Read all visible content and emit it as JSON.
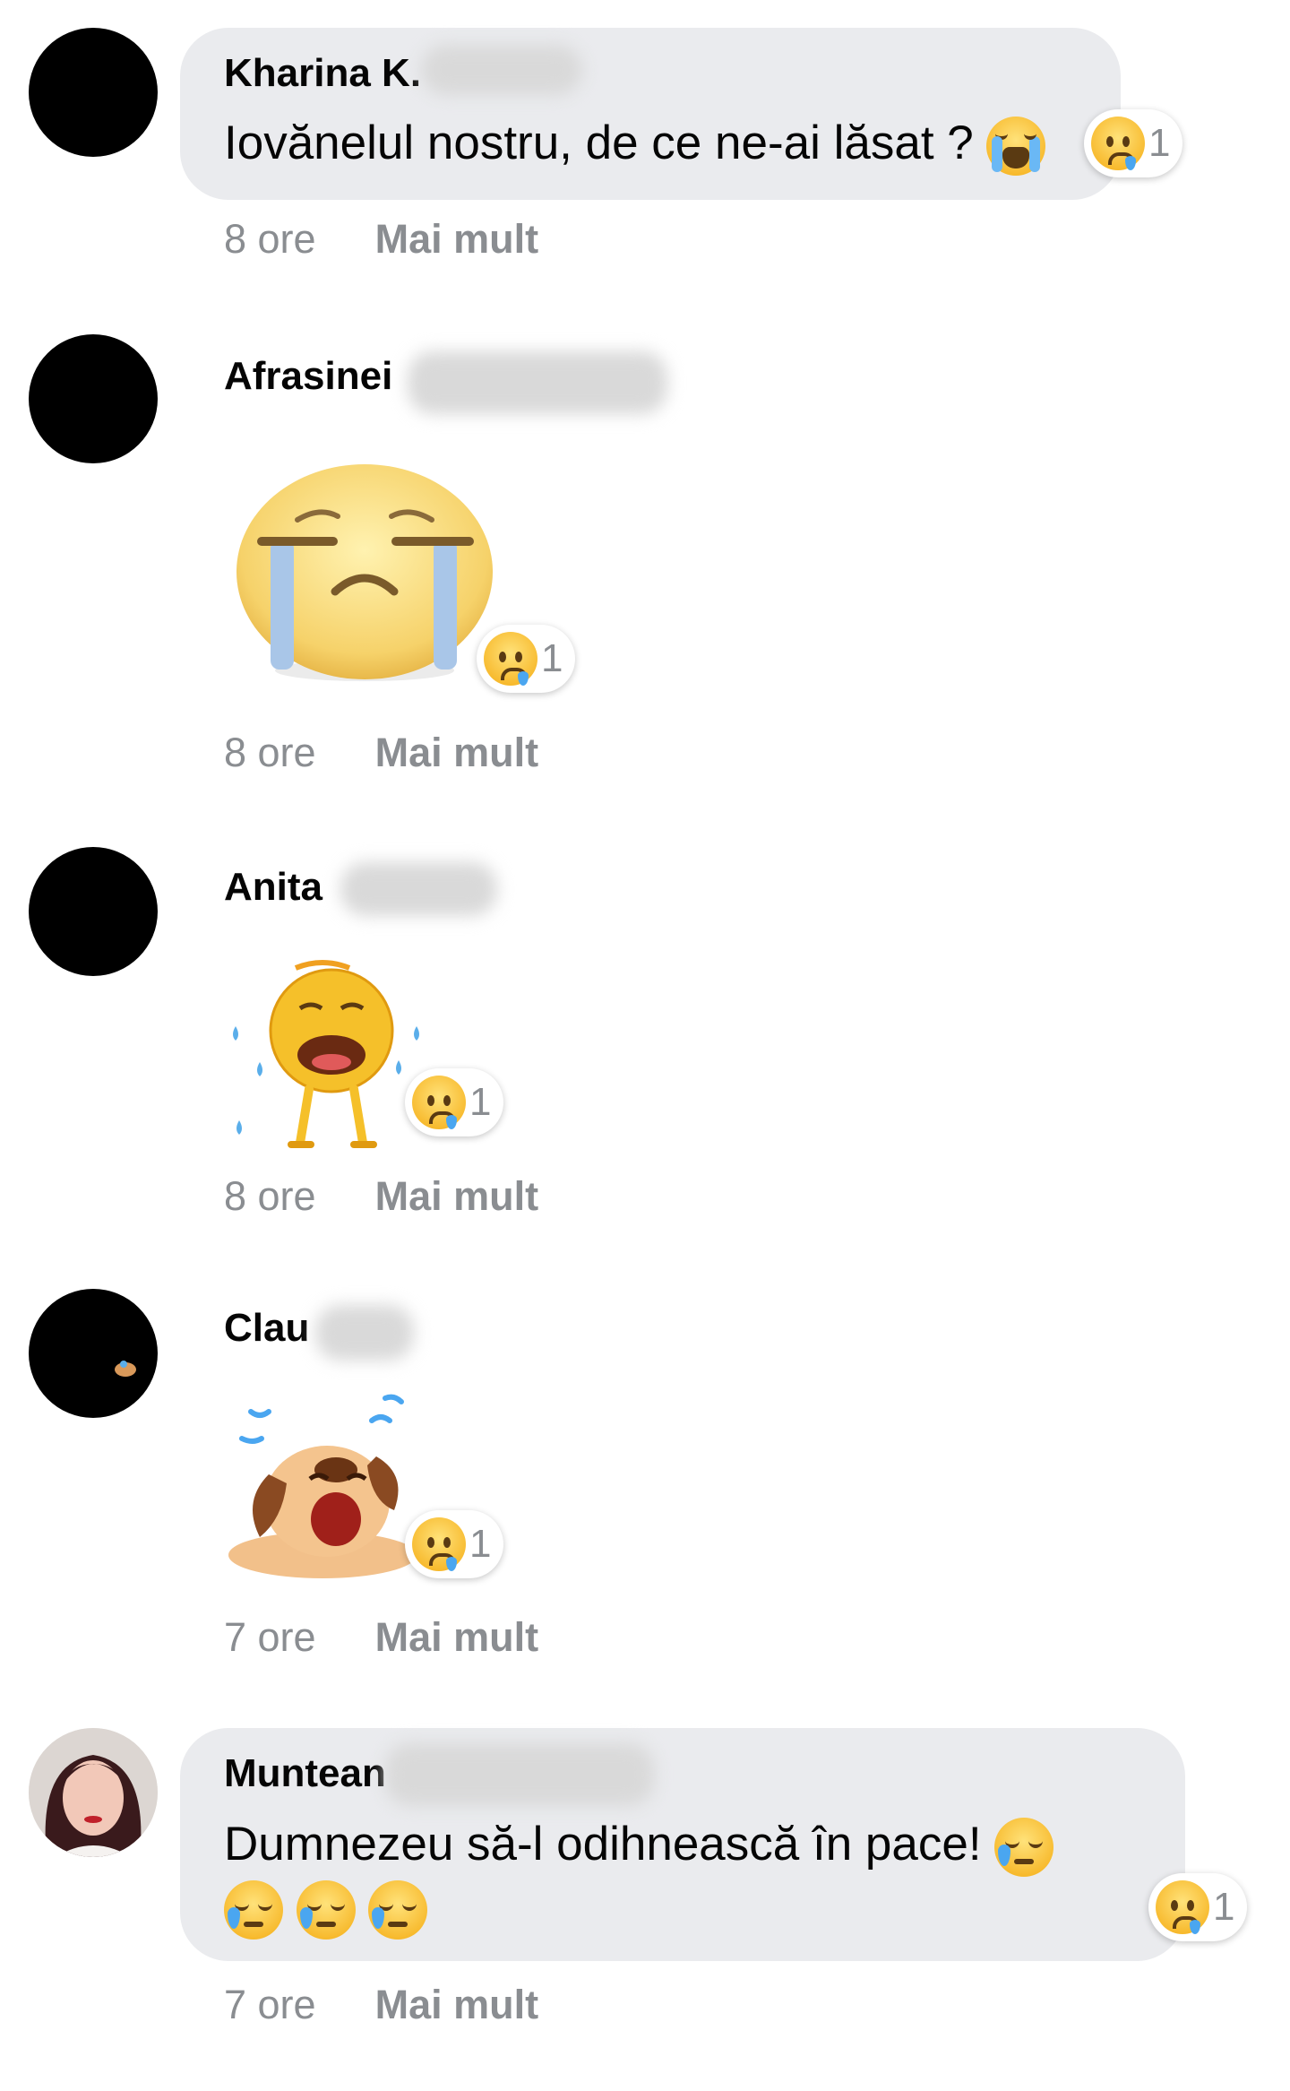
{
  "comments": [
    {
      "author": "Kharina K.",
      "text": "Iovănelul nostru, de ce ne-ai lăsat ?",
      "text_emoji": "loudly-crying-face",
      "reaction_icon": "crying-face-icon",
      "reaction_count": "1",
      "time": "8 ore",
      "more": "Mai mult"
    },
    {
      "author": "Afrasinei",
      "sticker": "big-crying-face-sticker",
      "reaction_icon": "crying-face-icon",
      "reaction_count": "1",
      "time": "8 ore",
      "more": "Mai mult"
    },
    {
      "author": "Anita",
      "sticker": "crying-emoji-character-sticker",
      "reaction_icon": "crying-face-icon",
      "reaction_count": "1",
      "time": "8 ore",
      "more": "Mai mult"
    },
    {
      "author": "Clau",
      "sticker": "crying-dog-sticker",
      "reaction_icon": "crying-face-icon",
      "reaction_count": "1",
      "time": "7 ore",
      "more": "Mai mult"
    },
    {
      "author": "Muntean",
      "text": "Dumnezeu să-l odihnească în pace!",
      "text_emoji": "sleepy-face",
      "reaction_icon": "crying-face-icon",
      "reaction_count": "1",
      "time": "7 ore",
      "more": "Mai mult"
    }
  ]
}
